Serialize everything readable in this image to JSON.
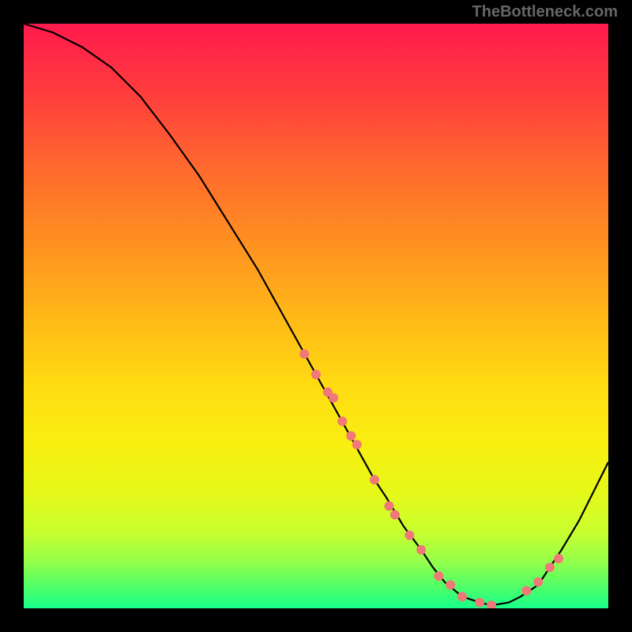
{
  "watermark": "TheBottleneck.com",
  "chart_data": {
    "type": "line",
    "title": "",
    "xlabel": "",
    "ylabel": "",
    "xlim": [
      0,
      100
    ],
    "ylim": [
      0,
      100
    ],
    "series": [
      {
        "name": "curve",
        "x": [
          0,
          5,
          10,
          15,
          20,
          25,
          30,
          35,
          40,
          45,
          50,
          55,
          60,
          62,
          65,
          68,
          70,
          72,
          75,
          78,
          80,
          83,
          85,
          88,
          90,
          92,
          95,
          98,
          100
        ],
        "y": [
          100,
          98.5,
          96,
          92.5,
          87.5,
          81,
          74,
          66,
          58,
          49,
          40,
          31,
          22,
          19,
          14,
          10,
          7,
          4.5,
          2,
          1,
          0.5,
          1,
          2,
          4,
          7,
          10,
          15,
          21,
          25
        ]
      }
    ],
    "markers": {
      "name": "points",
      "x": [
        48,
        50,
        52,
        53,
        54.5,
        56,
        57,
        60,
        62.5,
        63.5,
        66,
        68,
        71,
        73,
        75,
        78,
        80,
        86,
        88,
        90,
        91.5
      ],
      "y": [
        43.5,
        40,
        37,
        36,
        32,
        29.5,
        28,
        22,
        17.5,
        16,
        12.5,
        10,
        5.5,
        4,
        2,
        1,
        0.5,
        3,
        4.5,
        7,
        8.5
      ]
    },
    "background": "rainbow-gradient"
  }
}
